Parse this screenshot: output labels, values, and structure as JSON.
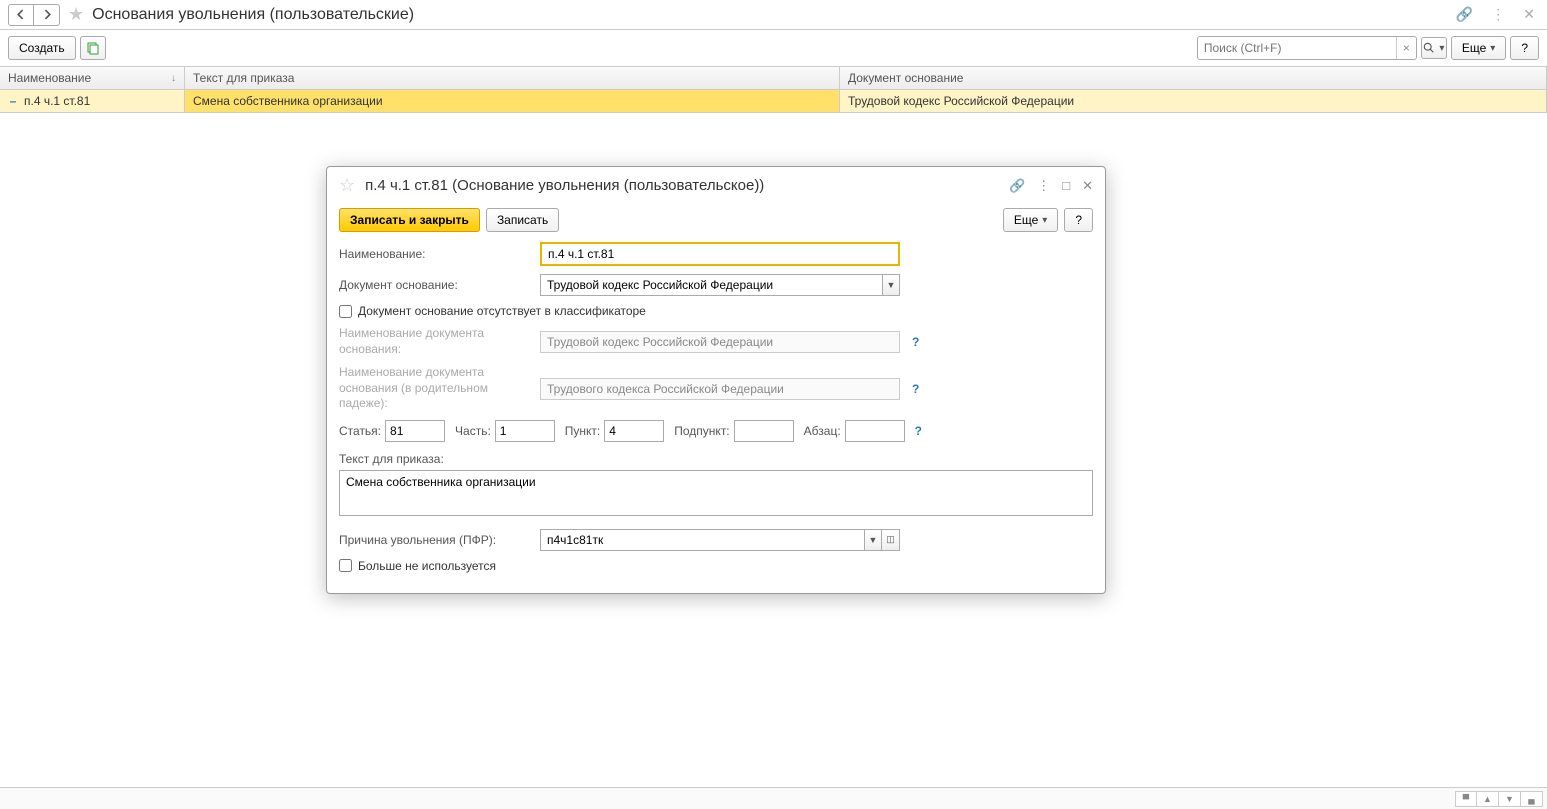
{
  "mainHeader": {
    "title": "Основания увольнения (пользовательские)"
  },
  "mainToolbar": {
    "create": "Создать",
    "moreBtn": "Еще",
    "helpBtn": "?",
    "searchPlaceholder": "Поиск (Ctrl+F)"
  },
  "table": {
    "headers": {
      "name": "Наименование",
      "text": "Текст для приказа",
      "doc": "Документ основание"
    },
    "row": {
      "name": "п.4 ч.1 ст.81",
      "text": "Смена собственника организации",
      "doc": "Трудовой кодекс Российской Федерации"
    }
  },
  "dialog": {
    "title": "п.4 ч.1 ст.81 (Основание увольнения (пользовательское))",
    "toolbar": {
      "saveClose": "Записать и закрыть",
      "save": "Записать",
      "more": "Еще",
      "help": "?"
    },
    "labels": {
      "name": "Наименование:",
      "docBase": "Документ основание:",
      "noClassifier": "Документ основание отсутствует в классификаторе",
      "docBaseName": "Наименование документа основания:",
      "docBaseNameGen": "Наименование документа основания (в родительном падеже):",
      "article": "Статья:",
      "part": "Часть:",
      "point": "Пункт:",
      "subpoint": "Подпункт:",
      "paragraph": "Абзац:",
      "orderText": "Текст для приказа:",
      "pfr": "Причина увольнения (ПФР):",
      "notUsed": "Больше не используется"
    },
    "values": {
      "name": "п.4 ч.1 ст.81",
      "docBase": "Трудовой кодекс Российской Федерации",
      "docBaseName": "Трудовой кодекс Российской Федерации",
      "docBaseNameGen": "Трудового кодекса Российской Федерации",
      "article": "81",
      "part": "1",
      "point": "4",
      "subpoint": "",
      "paragraph": "",
      "orderText": "Смена собственника организации",
      "pfr": "п4ч1с81тк"
    }
  }
}
